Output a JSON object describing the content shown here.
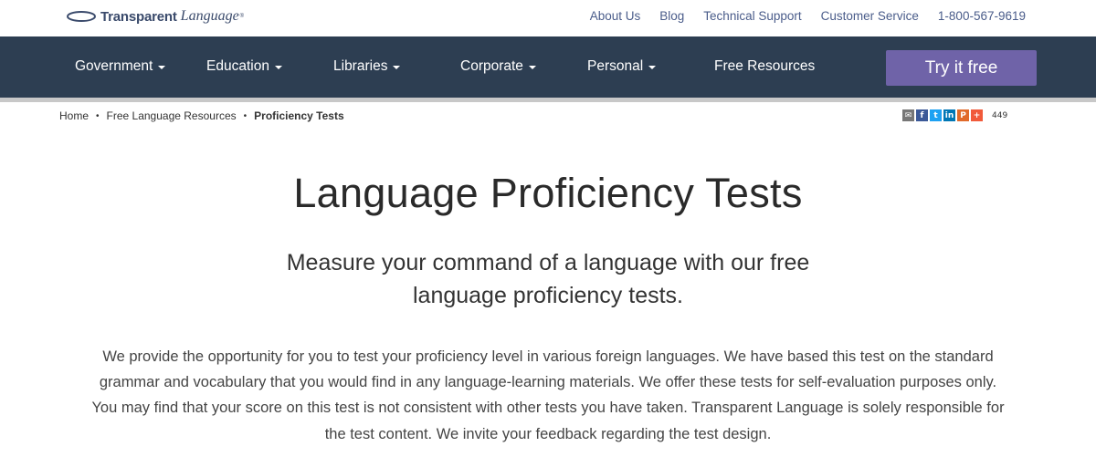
{
  "header": {
    "logo": {
      "brand_bold": "Transparent",
      "brand_italic": "Language",
      "trademark": "®",
      "icon": "swoosh-logo-icon"
    },
    "utility_links": [
      "About Us",
      "Blog",
      "Technical Support",
      "Customer Service",
      "1-800-567-9619"
    ]
  },
  "nav": {
    "items": [
      {
        "label": "Government",
        "dropdown": true
      },
      {
        "label": "Education",
        "dropdown": true
      },
      {
        "label": "Libraries",
        "dropdown": true
      },
      {
        "label": "Corporate",
        "dropdown": true
      },
      {
        "label": "Personal",
        "dropdown": true
      },
      {
        "label": "Free Resources",
        "dropdown": false
      }
    ],
    "cta_label": "Try it free",
    "colors": {
      "background": "#2d3e52",
      "cta": "#6f63a8"
    }
  },
  "breadcrumb": {
    "items": [
      "Home",
      "Free Language Resources"
    ],
    "current": "Proficiency Tests",
    "separator": "•"
  },
  "share": {
    "icons": [
      "email-icon",
      "facebook-icon",
      "twitter-icon",
      "linkedin-icon",
      "pinterest-icon",
      "add-share-icon"
    ],
    "count": "449"
  },
  "main": {
    "title": "Language Proficiency Tests",
    "subtitle_line1": "Measure your command of a language with our free",
    "subtitle_line2": "language proficiency tests.",
    "intro_line1": "We provide the opportunity for you to test your proficiency level in various foreign languages. We have based this test on the standard",
    "intro_line2": "grammar and vocabulary that you would find in any language-learning materials. We offer these tests for self-evaluation purposes only.",
    "intro_line3": "You may find that your score on this test is not consistent with other tests you have taken. Transparent Language is solely responsible for",
    "intro_line4": "the test content. We invite your feedback regarding the test design."
  }
}
